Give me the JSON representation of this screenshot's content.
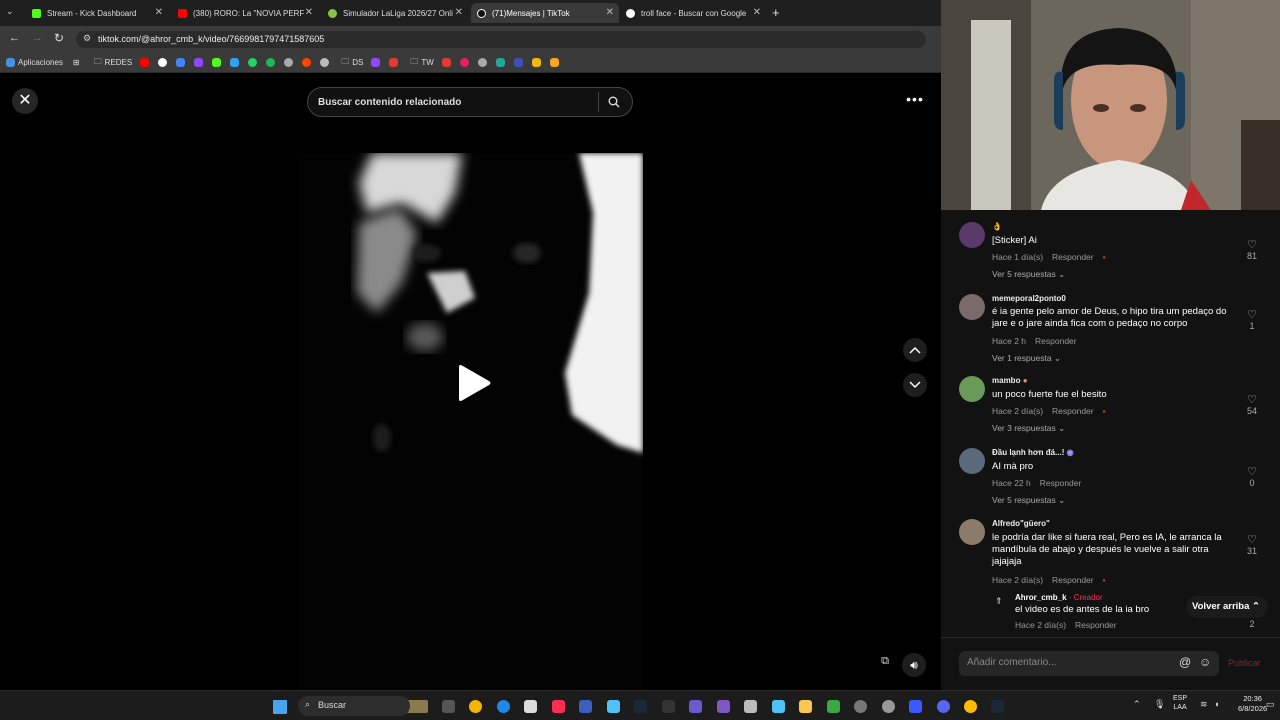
{
  "browser": {
    "tabs": [
      {
        "title": "Stream - Kick Dashboard",
        "color": "#53fc18",
        "active": false
      },
      {
        "title": "(380) RORO: La \"NOVIA PERFEC",
        "color": "#ff0000",
        "active": false
      },
      {
        "title": "Simulador LaLiga 2026/27 Onli",
        "color": "#8bc34a",
        "active": false
      },
      {
        "title": "(71)Mensajes | TikTok",
        "color": "#ffffff",
        "active": true
      },
      {
        "title": "troll face - Buscar con Google",
        "color": "#ffffff",
        "active": false
      }
    ],
    "url": "tiktok.com/@ahror_cmb_k/video/7669981797471587605",
    "bookmarks": {
      "apps": "Aplicaciones",
      "redes": "REDES",
      "ds": "DS",
      "tw": "TW"
    }
  },
  "video": {
    "search_placeholder": "Buscar contenido relacionado"
  },
  "comments": [
    {
      "user": "",
      "text": "[Sticker] Ai",
      "time": "Hace 1 día(s)",
      "reply": "Responder",
      "replies": "Ver 5 respuestas",
      "likes": "81",
      "avatar": "#5a3a6a"
    },
    {
      "user": "memeporal2ponto0",
      "text": "é ia gente pelo amor de Deus, o hipo tira um pedaço do jare e o jare ainda fica com o pedaço no corpo",
      "time": "Hace 2 h",
      "reply": "Responder",
      "replies": "Ver 1 respuesta",
      "likes": "1",
      "avatar": "#7a6a6a"
    },
    {
      "user": "mambo",
      "text": "un poco fuerte fue el besito",
      "time": "Hace 2 día(s)",
      "reply": "Responder",
      "replies": "Ver 3 respuestas",
      "likes": "54",
      "avatar": "#6a9a5a"
    },
    {
      "user": "Đầu lạnh hơn đá...!",
      "text": "AI mà pro",
      "time": "Hace 22 h",
      "reply": "Responder",
      "replies": "Ver 5 respuestas",
      "likes": "0",
      "avatar": "#5a6a7a"
    },
    {
      "user": "Alfredo\"güero\"",
      "text": "le podría dar like si fuera real, Pero es IA, le arranca la mandíbula de abajo y después le vuelve a salir otra jajajaja",
      "time": "Hace 2 día(s)",
      "reply": "Responder",
      "replies": "",
      "likes": "31",
      "avatar": "#8a7a6a"
    }
  ],
  "creator_reply": {
    "user": "Ahror_cmb_k",
    "badge": "· Creador",
    "text": "el video es de antes de la ia bro",
    "time": "Hace 2 día(s)",
    "reply": "Responder",
    "likes": "2"
  },
  "ui": {
    "back_to_top": "Volver arriba",
    "add_comment": "Añadir comentario...",
    "publish": "Publicar"
  },
  "taskbar": {
    "search": "Buscar",
    "lang1": "ESP",
    "lang2": "LAA",
    "time": "20:36",
    "date": "6/8/2026"
  }
}
